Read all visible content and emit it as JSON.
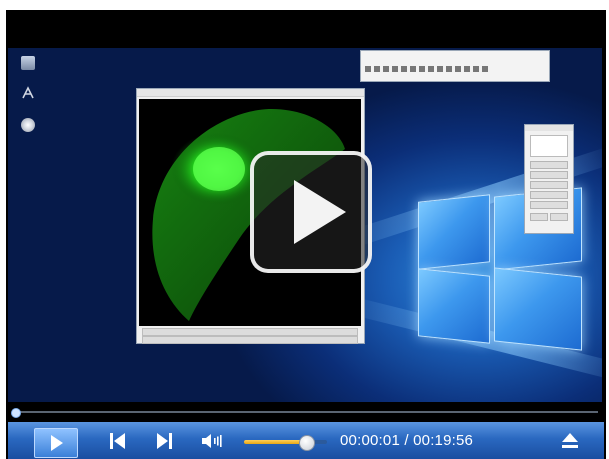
{
  "player": {
    "time_current": "00:00:01",
    "time_separator": " / ",
    "time_total": "00:19:56",
    "seek_progress": 0.0,
    "volume_level": 0.75,
    "accent_color": "#3a7fd8",
    "volume_color": "#e8a614"
  },
  "controls": {
    "play_icon": "play-icon",
    "prev_icon": "skip-previous-icon",
    "next_icon": "skip-next-icon",
    "volume_icon": "volume-icon",
    "eject_icon": "eject-icon"
  }
}
